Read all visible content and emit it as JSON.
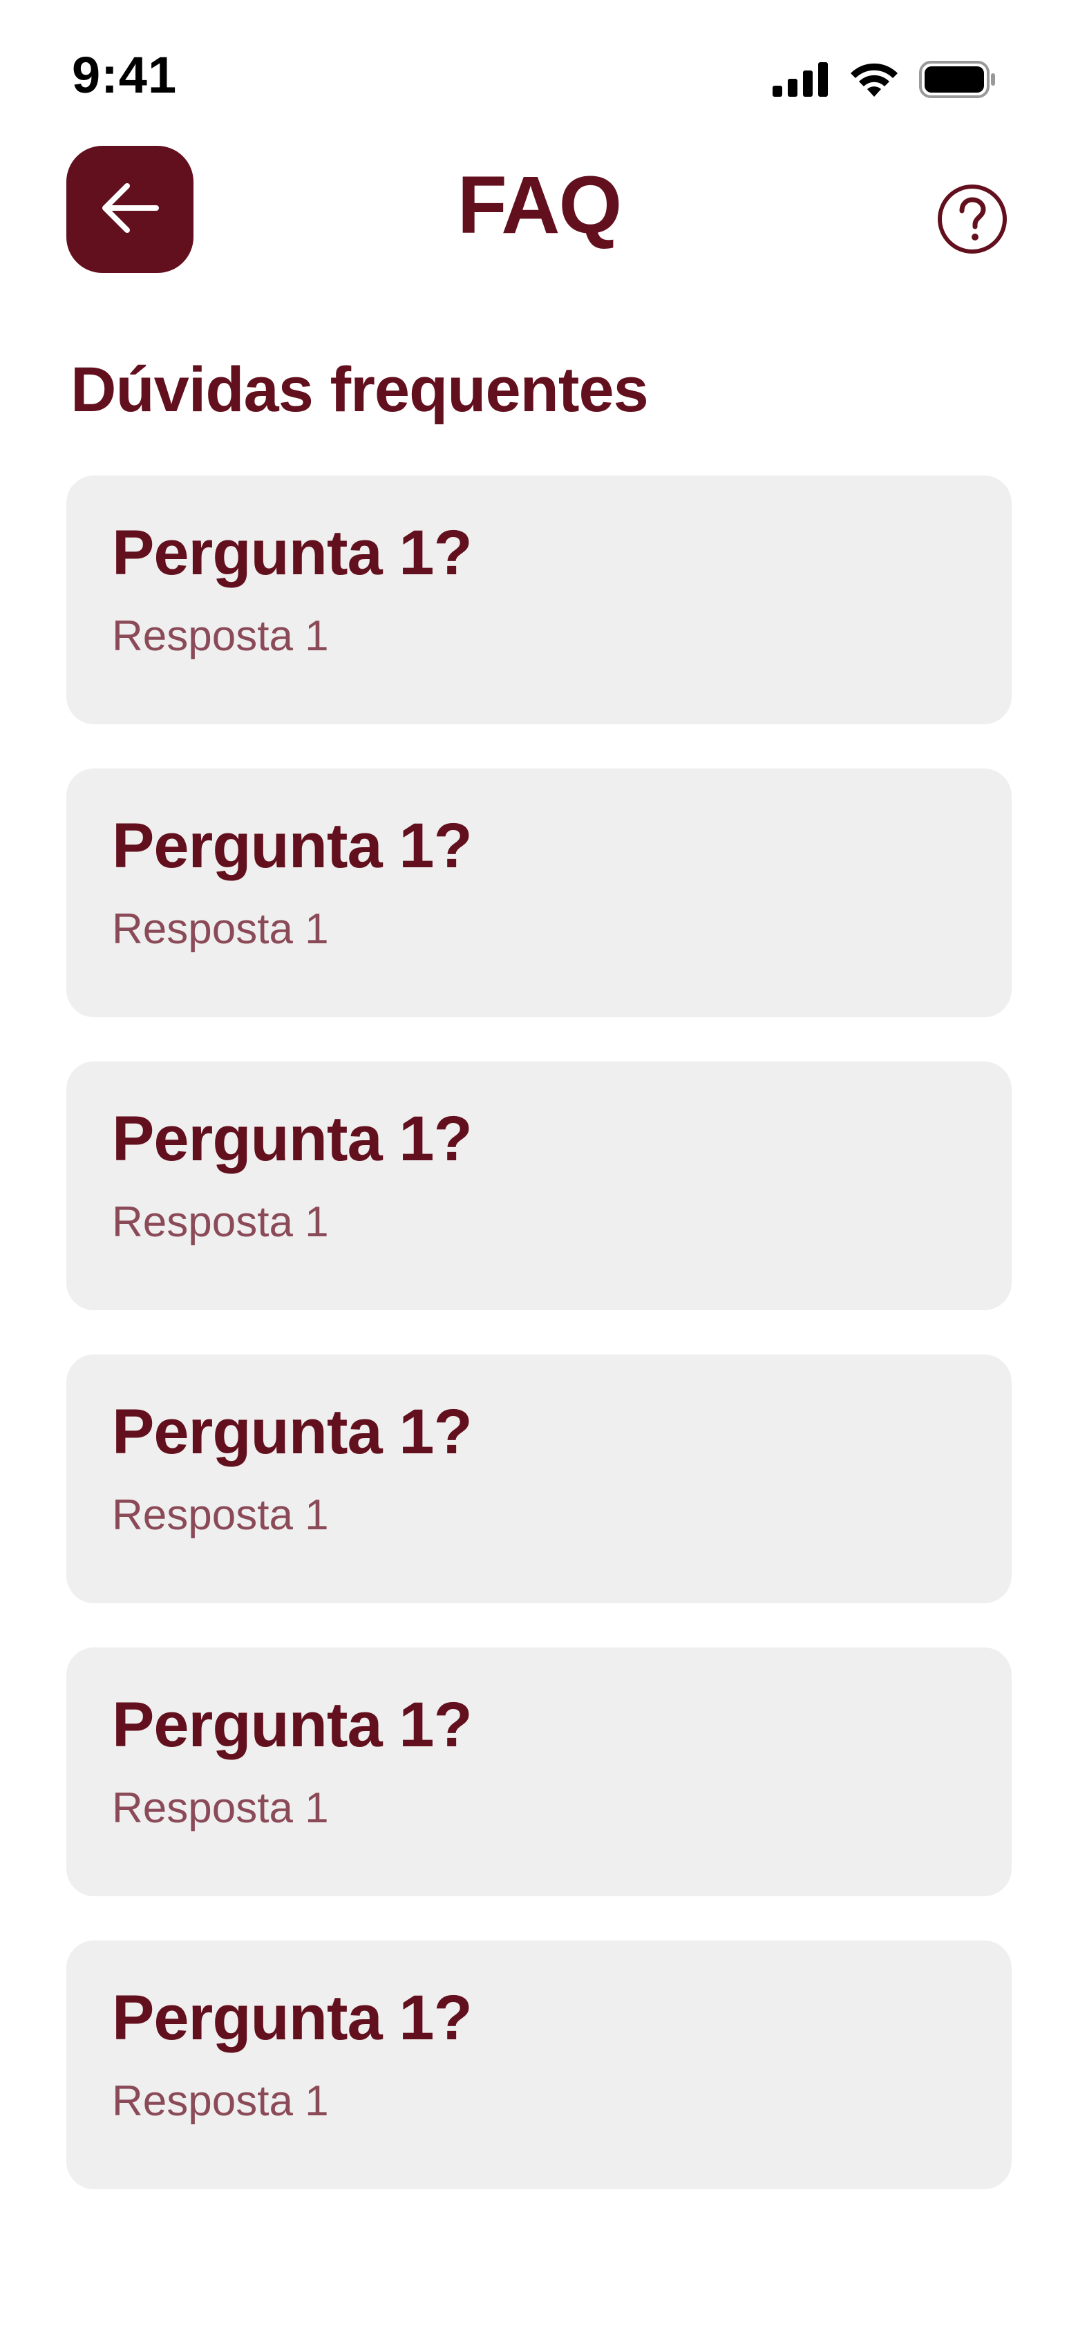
{
  "status_bar": {
    "time": "9:41"
  },
  "header": {
    "title": "FAQ",
    "back_icon": "arrow-left-icon",
    "help_icon": "question-circle-icon"
  },
  "section": {
    "title": "Dúvidas frequentes"
  },
  "faq": {
    "items": [
      {
        "question": "Pergunta 1?",
        "answer": "Resposta 1"
      },
      {
        "question": "Pergunta 1?",
        "answer": "Resposta 1"
      },
      {
        "question": "Pergunta 1?",
        "answer": "Resposta 1"
      },
      {
        "question": "Pergunta 1?",
        "answer": "Resposta 1"
      },
      {
        "question": "Pergunta 1?",
        "answer": "Resposta 1"
      },
      {
        "question": "Pergunta 1?",
        "answer": "Resposta 1"
      }
    ]
  },
  "colors": {
    "primary": "#63101e",
    "card_background": "#f0efef",
    "answer_text": "#8a4a58",
    "background": "#ffffff"
  }
}
